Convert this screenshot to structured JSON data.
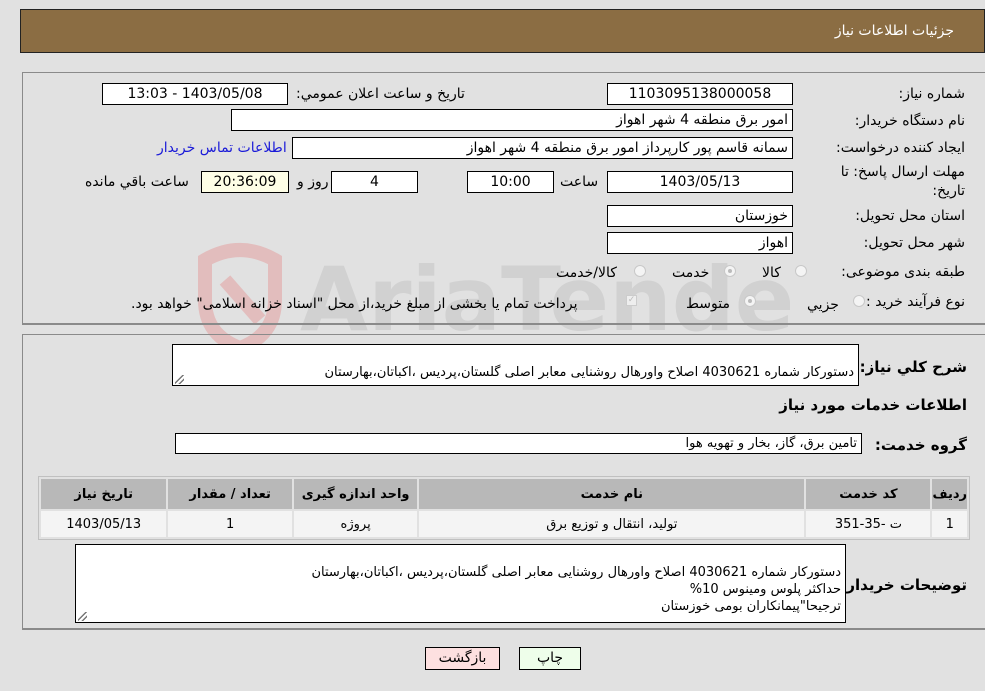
{
  "header": {
    "title": "جزئیات اطلاعات نیاز"
  },
  "form": {
    "need_number": {
      "label": "شماره نیاز:",
      "value": "1103095138000058"
    },
    "announce": {
      "label": "تاریخ و ساعت اعلان عمومي:",
      "value": "1403/05/08 - 13:03"
    },
    "buyer_org": {
      "label": "نام دستگاه خریدار:",
      "value": "امور برق منطقه 4 شهر اهواز"
    },
    "requester": {
      "label": "ایجاد کننده درخواست:",
      "value": "سمانه قاسم پور کارپرداز امور برق منطقه 4 شهر اهواز",
      "contact_link": "اطلاعات تماس خریدار"
    },
    "deadline": {
      "label_line1": "مهلت ارسال پاسخ: تا",
      "label_line2": "تاریخ:",
      "date": "1403/05/13",
      "time_label": "ساعت",
      "time": "10:00",
      "days": "4",
      "days_label": "روز و",
      "remaining": "20:36:09",
      "remaining_label": "ساعت باقي مانده"
    },
    "province": {
      "label": "استان محل تحویل:",
      "value": "خوزستان"
    },
    "city": {
      "label": "شهر محل تحویل:",
      "value": "اهواز"
    },
    "category": {
      "label": "طبقه بندی موضوعی:",
      "options": [
        "کالا",
        "خدمت",
        "کالا/خدمت"
      ],
      "selected": "خدمت"
    },
    "process": {
      "label": "نوع فرآیند خرید :",
      "options": [
        "جزیي",
        "متوسط"
      ],
      "selected": "متوسط",
      "treasury_note": "پرداخت تمام یا بخشی از مبلغ خرید،از محل \"اسناد خزانه اسلامی\" خواهد بود."
    }
  },
  "details": {
    "general_desc_label": "شرح كلي نياز:",
    "general_desc": "دستورکار شماره 4030621 اصلاح واورهال روشنایی معابر اصلی گلستان،پردیس ،اکباتان،بهارستان",
    "services_heading": "اطلاعات خدمات مورد نیاز",
    "service_group_label": "گروه خدمت:",
    "service_group": "تامین برق، گاز، بخار و تهویه هوا",
    "table": {
      "headers": [
        "ردیف",
        "کد خدمت",
        "نام خدمت",
        "واحد اندازه گیری",
        "تعداد / مقدار",
        "تاریخ نیاز"
      ],
      "rows": [
        [
          "1",
          "ت -35-351",
          "تولید، انتقال و توزیع برق",
          "پروژه",
          "1",
          "1403/05/13"
        ]
      ]
    },
    "buyer_notes_label": "توضیحات خریدار:",
    "buyer_notes": "دستورکار شماره 4030621 اصلاح واورهال روشنایی معابر اصلی گلستان،پردیس ،اکباتان،بهارستان\nحداکثر پلوس ومینوس 10%\nترجیحا\"پیمانکاران بومی خوزستان"
  },
  "buttons": {
    "print": "چاپ",
    "back": "بازگشت"
  },
  "colors": {
    "header_bg": "#8b6d43",
    "print_bg": "#eefeea",
    "back_bg": "#fde0e0",
    "link": "#1a1ad8"
  }
}
